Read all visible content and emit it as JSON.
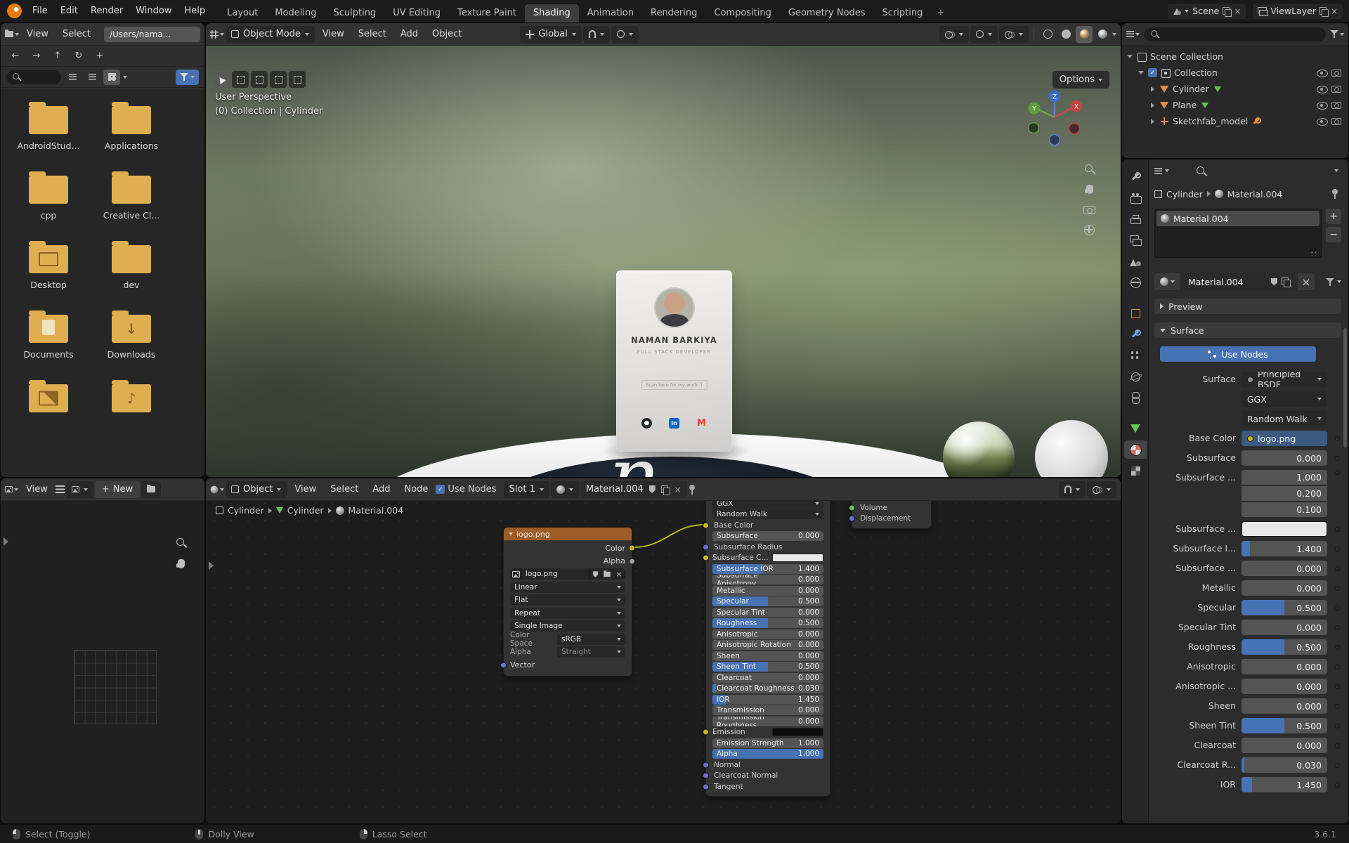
{
  "topbar": {
    "menus": [
      "File",
      "Edit",
      "Render",
      "Window",
      "Help"
    ],
    "tabs": [
      {
        "label": "Layout"
      },
      {
        "label": "Modeling"
      },
      {
        "label": "Sculpting"
      },
      {
        "label": "UV Editing"
      },
      {
        "label": "Texture Paint"
      },
      {
        "label": "Shading",
        "active": true
      },
      {
        "label": "Animation"
      },
      {
        "label": "Rendering"
      },
      {
        "label": "Compositing"
      },
      {
        "label": "Geometry Nodes"
      },
      {
        "label": "Scripting"
      }
    ],
    "add_tab": "+",
    "scene_label": "Scene",
    "viewlayer_label": "ViewLayer"
  },
  "file_browser": {
    "menus": [
      "View",
      "Select"
    ],
    "path": "/Users/nama...",
    "folders": [
      {
        "name": "AndroidStud...",
        "glyph": "plain"
      },
      {
        "name": "Applications",
        "glyph": "plain"
      },
      {
        "name": "cpp",
        "glyph": "plain"
      },
      {
        "name": "Creative Cl...",
        "glyph": "plain"
      },
      {
        "name": "Desktop",
        "glyph": "desktop"
      },
      {
        "name": "dev",
        "glyph": "plain"
      },
      {
        "name": "Documents",
        "glyph": "document"
      },
      {
        "name": "Downloads",
        "glyph": "download"
      },
      {
        "name": "",
        "glyph": "image"
      },
      {
        "name": "",
        "glyph": "music"
      }
    ]
  },
  "viewport": {
    "mode": "Object Mode",
    "menus": [
      "View",
      "Select",
      "Add",
      "Object"
    ],
    "orientation": "Global",
    "options": "Options",
    "overlay": {
      "line1": "User Perspective",
      "line2": "(0) Collection | Cylinder"
    },
    "gizmo": {
      "x": "X",
      "y": "Y",
      "z": "Z"
    },
    "platform_letter": "n",
    "card": {
      "name": "NAMAN BARKIYA",
      "title": "FULL STACK DEVELOPER",
      "note": "Scan here for my work :)"
    }
  },
  "shader_editor": {
    "type": "Object",
    "menus": [
      "View",
      "Select",
      "Add",
      "Node"
    ],
    "use_nodes": "Use Nodes",
    "slot": "Slot 1",
    "material": "Material.004",
    "breadcrumb": [
      "Cylinder",
      "Cylinder",
      "Material.004"
    ],
    "image_node": {
      "title": "logo.png",
      "outputs": [
        "Color",
        "Alpha"
      ],
      "image_name": "logo.png",
      "interpolation": "Linear",
      "projection": "Flat",
      "extension": "Repeat",
      "source": "Single Image",
      "color_space_label": "Color Space",
      "color_space": "sRGB",
      "alpha_label": "Alpha",
      "alpha_mode": "Straight",
      "input": "Vector"
    },
    "bsdf_node": {
      "distribution": "GGX",
      "subsurface_method": "Random Walk",
      "rows": [
        {
          "label": "Base Color",
          "type": "plain",
          "socket": "yellow"
        },
        {
          "label": "Subsurface",
          "type": "num",
          "value": "0.000",
          "socket": "grey"
        },
        {
          "label": "Subsurface Radius",
          "type": "plain",
          "socket": "vector"
        },
        {
          "label": "Subsurface C...",
          "type": "swatch",
          "swatch": "#e8e8e8",
          "socket": "yellow"
        },
        {
          "label": "Subsurface IOR",
          "type": "num",
          "value": "1.400",
          "fill": 0.45,
          "socket": "grey"
        },
        {
          "label": "Subsurface Anisotropy",
          "type": "num",
          "value": "0.000",
          "socket": "grey"
        },
        {
          "label": "Metallic",
          "type": "num",
          "value": "0.000",
          "socket": "grey"
        },
        {
          "label": "Specular",
          "type": "num",
          "value": "0.500",
          "fill": 0.5,
          "socket": "grey"
        },
        {
          "label": "Specular Tint",
          "type": "num",
          "value": "0.000",
          "socket": "grey"
        },
        {
          "label": "Roughness",
          "type": "num",
          "value": "0.500",
          "fill": 0.5,
          "socket": "grey"
        },
        {
          "label": "Anisotropic",
          "type": "num",
          "value": "0.000",
          "socket": "grey"
        },
        {
          "label": "Anisotropic Rotation",
          "type": "num",
          "value": "0.000",
          "socket": "grey"
        },
        {
          "label": "Sheen",
          "type": "num",
          "value": "0.000",
          "socket": "grey"
        },
        {
          "label": "Sheen Tint",
          "type": "num",
          "value": "0.500",
          "fill": 0.5,
          "socket": "grey"
        },
        {
          "label": "Clearcoat",
          "type": "num",
          "value": "0.000",
          "socket": "grey"
        },
        {
          "label": "Clearcoat Roughness",
          "type": "num",
          "value": "0.030",
          "fill": 0.03,
          "socket": "grey"
        },
        {
          "label": "IOR",
          "type": "num",
          "value": "1.450",
          "fill": 0.12,
          "socket": "grey"
        },
        {
          "label": "Transmission",
          "type": "num",
          "value": "0.000",
          "socket": "grey"
        },
        {
          "label": "Transmission Roughness",
          "type": "num",
          "value": "0.000",
          "socket": "grey"
        },
        {
          "label": "Emission",
          "type": "swatch",
          "swatch": "#0c0c0c",
          "socket": "yellow"
        },
        {
          "label": "Emission Strength",
          "type": "num",
          "value": "1.000",
          "socket": "grey"
        },
        {
          "label": "Alpha",
          "type": "num",
          "value": "1.000",
          "fill": 1,
          "socket": "grey"
        },
        {
          "label": "Normal",
          "type": "plain",
          "socket": "vector"
        },
        {
          "label": "Clearcoat Normal",
          "type": "plain",
          "socket": "vector"
        },
        {
          "label": "Tangent",
          "type": "plain",
          "socket": "vector"
        }
      ]
    },
    "output_node": {
      "rows": [
        "Volume",
        "Displacement"
      ]
    }
  },
  "image_editor": {
    "view_label": "View",
    "new_label": "New"
  },
  "outliner": {
    "rows": [
      {
        "label": "Scene Collection",
        "icon": "scene",
        "indent": 0,
        "disclosure": "down",
        "checkbox": false,
        "eye": false,
        "cam": false
      },
      {
        "label": "Collection",
        "icon": "collection",
        "indent": 1,
        "disclosure": "down",
        "checkbox": true,
        "eye": true,
        "cam": true
      },
      {
        "label": "Cylinder",
        "icon": "object",
        "indent": 2,
        "disclosure": "right",
        "data_icon": "mesh",
        "eye": true,
        "cam": true
      },
      {
        "label": "Plane",
        "icon": "object",
        "indent": 2,
        "disclosure": "right",
        "data_icon": "mesh",
        "eye": true,
        "cam": true
      },
      {
        "label": "Sketchfab_model",
        "icon": "empty",
        "indent": 2,
        "disclosure": "right",
        "data_icon": "wrench",
        "eye": true,
        "cam": true
      }
    ]
  },
  "properties": {
    "tabs": [
      "tool",
      "render",
      "output",
      "viewlayer",
      "scene",
      "world",
      "gap",
      "object",
      "modifiers",
      "particles",
      "physics",
      "constraints",
      "gap",
      "data",
      "material",
      "texture"
    ],
    "active_tab": "material",
    "breadcrumb": [
      "Cylinder",
      "Material.004"
    ],
    "slot_name": "Material.004",
    "datablock_name": "Material.004",
    "preview_label": "Preview",
    "surface_label": "Surface",
    "use_nodes": "Use Nodes",
    "rows": [
      {
        "label": "Surface",
        "type": "menu",
        "value": "Principled BSDF"
      },
      {
        "label": "",
        "type": "dropdown",
        "value": "GGX"
      },
      {
        "label": "",
        "type": "dropdown",
        "value": "Random Walk"
      },
      {
        "label": "Base Color",
        "type": "texture",
        "value": "logo.png"
      },
      {
        "label": "Subsurface",
        "type": "num",
        "value": "0.000"
      },
      {
        "label": "Subsurface ...",
        "type": "vector",
        "values": [
          "1.000",
          "0.200",
          "0.100"
        ]
      },
      {
        "label": "Subsurface ...",
        "type": "swatch",
        "swatch": "#e8e8e8"
      },
      {
        "label": "Subsurface I...",
        "type": "num",
        "value": "1.400",
        "fill": 0.1
      },
      {
        "label": "Subsurface ...",
        "type": "num",
        "value": "0.000"
      },
      {
        "label": "Metallic",
        "type": "num",
        "value": "0.000"
      },
      {
        "label": "Specular",
        "type": "num",
        "value": "0.500",
        "fill": 0.5
      },
      {
        "label": "Specular Tint",
        "type": "num",
        "value": "0.000"
      },
      {
        "label": "Roughness",
        "type": "num",
        "value": "0.500",
        "fill": 0.5
      },
      {
        "label": "Anisotropic",
        "type": "num",
        "value": "0.000"
      },
      {
        "label": "Anisotropic ...",
        "type": "num",
        "value": "0.000"
      },
      {
        "label": "Sheen",
        "type": "num",
        "value": "0.000"
      },
      {
        "label": "Sheen Tint",
        "type": "num",
        "value": "0.500",
        "fill": 0.5
      },
      {
        "label": "Clearcoat",
        "type": "num",
        "value": "0.000"
      },
      {
        "label": "Clearcoat R...",
        "type": "num",
        "value": "0.030",
        "fill": 0.03
      },
      {
        "label": "IOR",
        "type": "num",
        "value": "1.450",
        "fill": 0.12
      }
    ]
  },
  "statusbar": {
    "items": [
      "Select (Toggle)",
      "Dolly View",
      "Lasso Select"
    ],
    "version": "3.6.1"
  }
}
